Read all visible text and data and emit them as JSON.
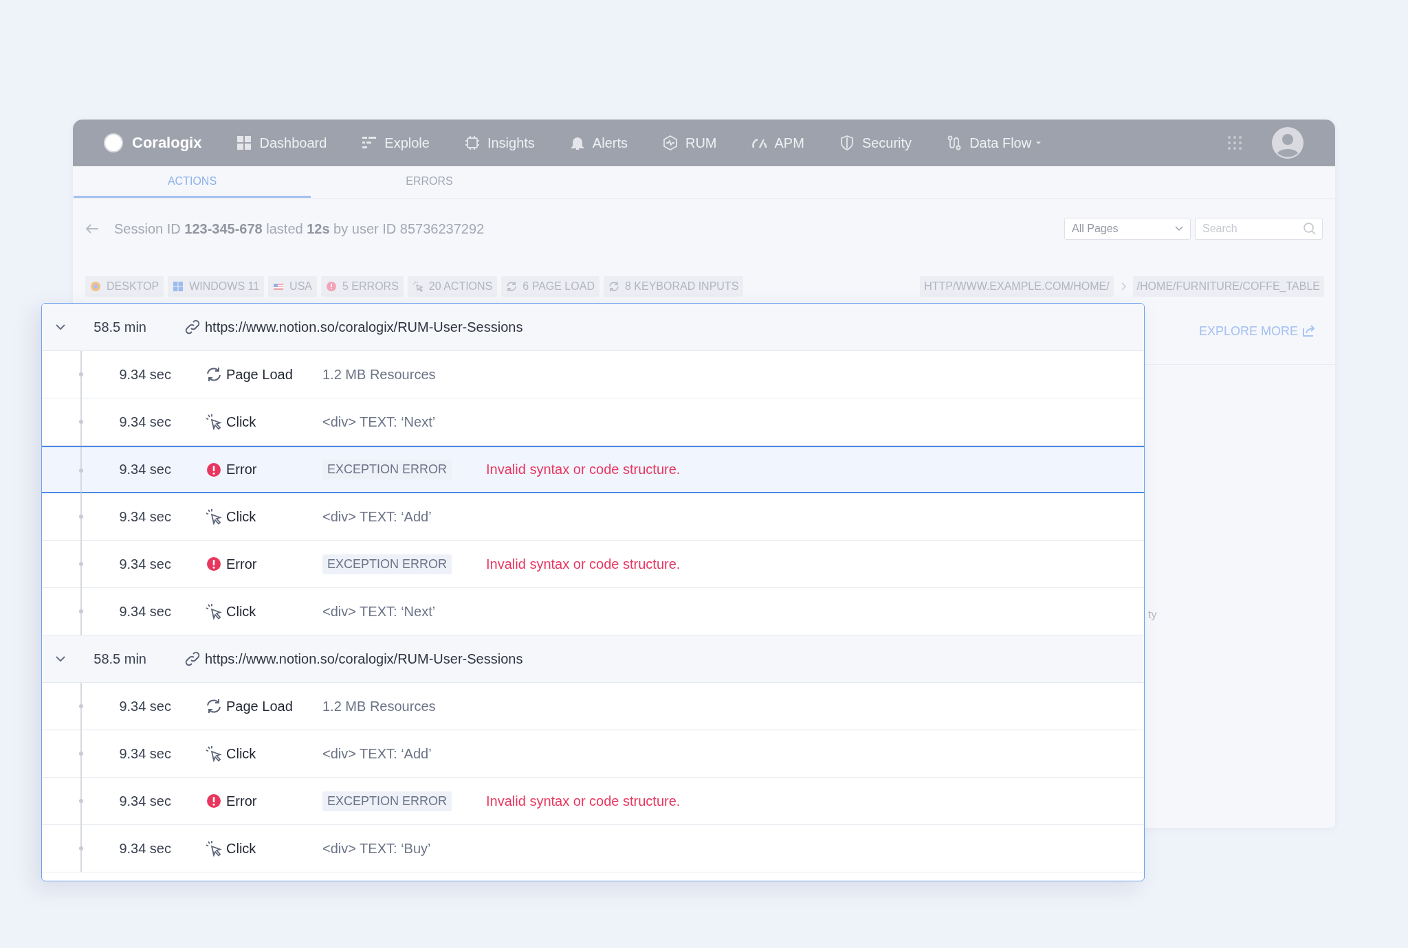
{
  "nav": {
    "brand": "Coralogix",
    "items": [
      {
        "kind": "dashboard",
        "label": "Dashboard"
      },
      {
        "kind": "explore",
        "label": "Explole"
      },
      {
        "kind": "chip",
        "label": "Insights"
      },
      {
        "kind": "bell",
        "label": "Alerts"
      },
      {
        "kind": "rum",
        "label": "RUM"
      },
      {
        "kind": "apm",
        "label": "APM"
      },
      {
        "kind": "shield",
        "label": "Security"
      },
      {
        "kind": "flow",
        "label": "Data Flow",
        "dropdown": true
      }
    ]
  },
  "tabs": [
    {
      "label": "ACTIONS",
      "selected": true
    },
    {
      "label": "ERRORS",
      "selected": false
    }
  ],
  "session": {
    "summary": "Session ID **123-345-678** lasted **12s** by user ID 85736237292",
    "page_filter": "All Pages",
    "search": {
      "placeholder": "Search"
    }
  },
  "tags": [
    {
      "kind": "browser",
      "label": "DESKTOP"
    },
    {
      "kind": "windows",
      "label": "WINDOWS 11"
    },
    {
      "kind": "flag",
      "label": "USA"
    },
    {
      "kind": "error",
      "label": "5 ERRORS"
    },
    {
      "kind": "click",
      "label": "20 ACTIONS"
    },
    {
      "kind": "reload",
      "label": "6 PAGE LOAD"
    },
    {
      "kind": "reload",
      "label": "8 KEYBORAD INPUTS"
    }
  ],
  "breadcrumb": [
    "HTTP/WWW.EXAMPLE.COM/HOME/",
    "/HOME/FURNITURE/COFFE_TABLE"
  ],
  "explore_more": "EXPLORE MORE",
  "background_fragment": "ty",
  "timeline": [
    {
      "time": "58.5 min",
      "url": "https://www.notion.so/coralogix/RUM-User-Sessions",
      "expanded": true,
      "events": [
        {
          "kind": "page_load",
          "time": "9.34 sec",
          "label": "Page Load",
          "detail": "1.2 MB Resources",
          "selected": false
        },
        {
          "kind": "click",
          "time": "9.34 sec",
          "label": "Click",
          "detail": "<div> TEXT: ‘Next’",
          "selected": false
        },
        {
          "kind": "error",
          "time": "9.34 sec",
          "label": "Error",
          "badge": "EXCEPTION ERROR",
          "message": "Invalid syntax or code structure.",
          "selected": true
        },
        {
          "kind": "click",
          "time": "9.34 sec",
          "label": "Click",
          "detail": "<div> TEXT: ‘Add’",
          "selected": false
        },
        {
          "kind": "error",
          "time": "9.34 sec",
          "label": "Error",
          "badge": "EXCEPTION ERROR",
          "message": "Invalid syntax or code structure.",
          "selected": false
        },
        {
          "kind": "click",
          "time": "9.34 sec",
          "label": "Click",
          "detail": "<div> TEXT: ‘Next’",
          "selected": false
        }
      ]
    },
    {
      "time": "58.5 min",
      "url": "https://www.notion.so/coralogix/RUM-User-Sessions",
      "expanded": true,
      "events": [
        {
          "kind": "page_load",
          "time": "9.34 sec",
          "label": "Page Load",
          "detail": "1.2 MB Resources",
          "selected": false
        },
        {
          "kind": "click",
          "time": "9.34 sec",
          "label": "Click",
          "detail": "<div> TEXT: ‘Add’",
          "selected": false
        },
        {
          "kind": "error",
          "time": "9.34 sec",
          "label": "Error",
          "badge": "EXCEPTION ERROR",
          "message": "Invalid syntax or code structure.",
          "selected": false
        },
        {
          "kind": "click",
          "time": "9.34 sec",
          "label": "Click",
          "detail": "<div> TEXT: ‘Buy’",
          "selected": false
        }
      ]
    }
  ]
}
